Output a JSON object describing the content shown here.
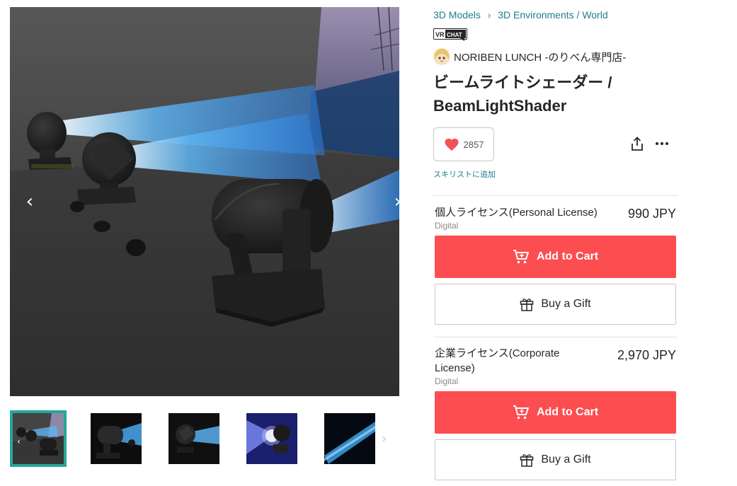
{
  "gallery": {
    "prev_label": "‹",
    "next_label": "›",
    "thumb_next_label": "›",
    "thumbnails": [
      {
        "name": "thumbnail-1",
        "active": true
      },
      {
        "name": "thumbnail-2",
        "active": false
      },
      {
        "name": "thumbnail-3",
        "active": false
      },
      {
        "name": "thumbnail-4",
        "active": false
      },
      {
        "name": "thumbnail-5",
        "active": false
      }
    ]
  },
  "breadcrumb": {
    "items": [
      "3D Models",
      "3D Environments / World"
    ],
    "separator": "›"
  },
  "badge": {
    "text": "VR CHAT"
  },
  "shop": {
    "name": "NORIBEN LUNCH -のりべん専門店-"
  },
  "product": {
    "title_line1": "ビームライトシェーダー /",
    "title_line2": "BeamLightShader"
  },
  "actions": {
    "like_count": "2857",
    "wishlist_text": "スキリストに追加",
    "heart_color": "#f1515a"
  },
  "licenses": [
    {
      "name": "個人ライセンス(Personal License)",
      "type": "Digital",
      "price": "990 JPY",
      "cart_label": "Add to Cart",
      "gift_label": "Buy a Gift"
    },
    {
      "name_line1": "企業ライセンス(Corporate",
      "name_line2": "License)",
      "type": "Digital",
      "price": "2,970 JPY",
      "cart_label": "Add to Cart",
      "gift_label": "Buy a Gift"
    }
  ],
  "colors": {
    "accent": "#fc4d50",
    "link": "#1e7e8c",
    "thumb_active_border": "#26a69a"
  },
  "icons": [
    "chevron-left-icon",
    "chevron-right-icon",
    "heart-icon",
    "share-icon",
    "more-icon",
    "cart-icon",
    "gift-icon"
  ]
}
